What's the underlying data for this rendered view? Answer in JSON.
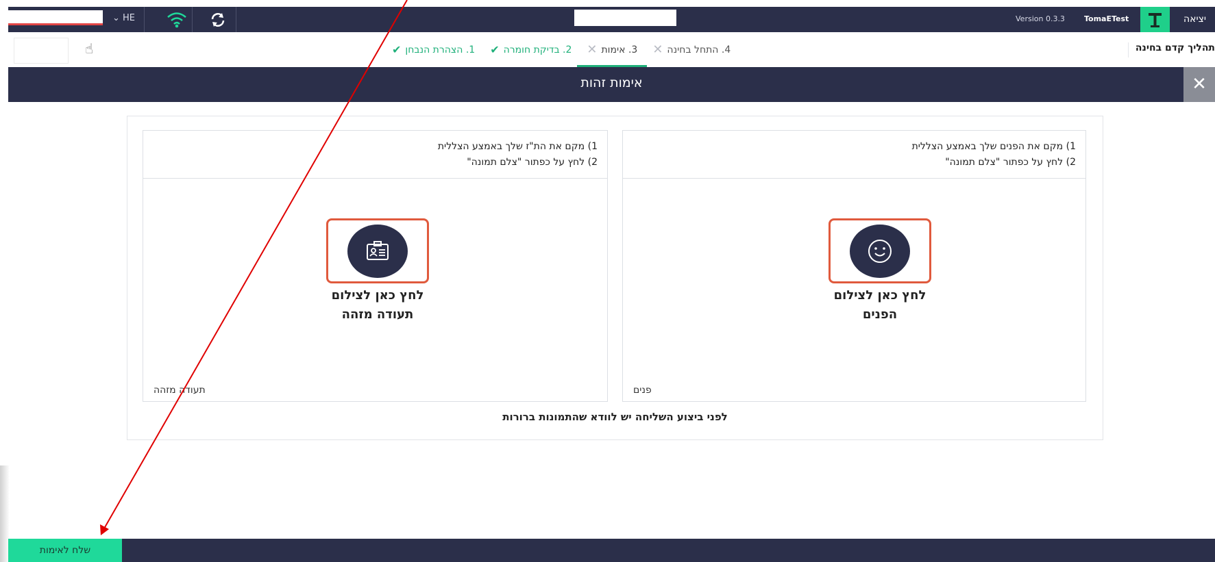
{
  "topbar": {
    "language": "HE",
    "version": "Version 0.3.3",
    "user": "TomaETest",
    "exit_label": "יציאה"
  },
  "steps": [
    {
      "label": "1. הצהרת הנבחן",
      "status": "done"
    },
    {
      "label": "2. בדיקת חומרה",
      "status": "done"
    },
    {
      "label": "3. אימות",
      "status": "active"
    },
    {
      "label": "4. התחל בחינה",
      "status": "todo"
    }
  ],
  "pre_exam_label": "תהליך קדם בחינה",
  "title": "אימות זהות",
  "panels": {
    "face": {
      "line1": "1) מקם את הפנים שלך באמצע הצללית",
      "line2": "2) לחץ על כפתור \"צלם תמונה\"",
      "capture_line1": "לחץ כאן לצילום",
      "capture_line2": "הפנים",
      "caption": "פנים"
    },
    "id": {
      "line1": "1) מקם את הת\"ז שלך באמצע הצללית",
      "line2": "2) לחץ על כפתור \"צלם תמונה\"",
      "capture_line1": "לחץ כאן לצילום",
      "capture_line2": "תעודה מזהה",
      "caption": "תעודה מזהה"
    }
  },
  "note": "לפני ביצוע השליחה יש לוודא שהתמונות ברורות",
  "footer": {
    "send_label": "שלח לאימות"
  },
  "colors": {
    "navy": "#2b2f4a",
    "green": "#1fd99a",
    "accent_red": "#e05a3d",
    "arrow": "#e00000"
  },
  "icons": [
    "wifi-icon",
    "refresh-icon",
    "mortarboard-icon",
    "hand-icon",
    "check-icon",
    "x-icon",
    "close-icon",
    "id-card-icon",
    "smiley-icon"
  ]
}
